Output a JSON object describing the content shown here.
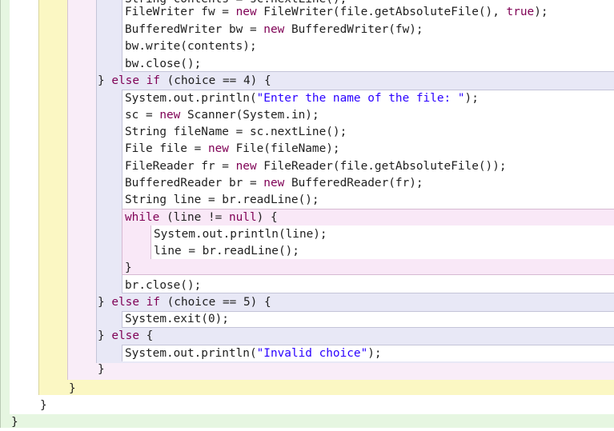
{
  "colors": {
    "class_bg": "#e6f6e1",
    "method_bg": "#fbf7c3",
    "loop_bg": "#f9edf8",
    "if_bg": "#e8e8f6",
    "block_bg": "#ffffff",
    "while_bg": "#f9e8f7"
  },
  "lines": [
    {
      "id": "l0",
      "parts": [
        [
          "plain",
          "String contents = sc.nextLine();"
        ]
      ]
    },
    {
      "id": "l1",
      "parts": [
        [
          "plain",
          "FileWriter fw = "
        ],
        [
          "kw",
          "new"
        ],
        [
          "plain",
          " FileWriter(file.getAbsoluteFile(), "
        ],
        [
          "kw",
          "true"
        ],
        [
          "plain",
          ");"
        ]
      ]
    },
    {
      "id": "l2",
      "parts": [
        [
          "plain",
          "BufferedWriter bw = "
        ],
        [
          "kw",
          "new"
        ],
        [
          "plain",
          " BufferedWriter(fw);"
        ]
      ]
    },
    {
      "id": "l3",
      "parts": [
        [
          "plain",
          "bw.write(contents);"
        ]
      ]
    },
    {
      "id": "l4",
      "parts": [
        [
          "plain",
          "bw.close();"
        ]
      ]
    },
    {
      "id": "l5",
      "parts": [
        [
          "plain",
          "} "
        ],
        [
          "kw",
          "else if"
        ],
        [
          "plain",
          " (choice == 4) {"
        ]
      ]
    },
    {
      "id": "l6",
      "parts": [
        [
          "plain",
          "System.out.println("
        ],
        [
          "str",
          "\"Enter the name of the file: \""
        ],
        [
          "plain",
          ");"
        ]
      ]
    },
    {
      "id": "l7",
      "parts": [
        [
          "plain",
          "sc = "
        ],
        [
          "kw",
          "new"
        ],
        [
          "plain",
          " Scanner(System.in);"
        ]
      ]
    },
    {
      "id": "l8",
      "parts": [
        [
          "plain",
          "String fileName = sc.nextLine();"
        ]
      ]
    },
    {
      "id": "l9",
      "parts": [
        [
          "plain",
          "File file = "
        ],
        [
          "kw",
          "new"
        ],
        [
          "plain",
          " File(fileName);"
        ]
      ]
    },
    {
      "id": "l10",
      "parts": [
        [
          "plain",
          "FileReader fr = "
        ],
        [
          "kw",
          "new"
        ],
        [
          "plain",
          " FileReader(file.getAbsoluteFile());"
        ]
      ]
    },
    {
      "id": "l11",
      "parts": [
        [
          "plain",
          "BufferedReader br = "
        ],
        [
          "kw",
          "new"
        ],
        [
          "plain",
          " BufferedReader(fr);"
        ]
      ]
    },
    {
      "id": "l12",
      "parts": [
        [
          "plain",
          "String line = br.readLine();"
        ]
      ]
    },
    {
      "id": "l13",
      "parts": [
        [
          "kw",
          "while"
        ],
        [
          "plain",
          " (line != "
        ],
        [
          "kw",
          "null"
        ],
        [
          "plain",
          ") {"
        ]
      ]
    },
    {
      "id": "l14",
      "parts": [
        [
          "plain",
          "System.out.println(line);"
        ]
      ]
    },
    {
      "id": "l15",
      "parts": [
        [
          "plain",
          "line = br.readLine();"
        ]
      ]
    },
    {
      "id": "l16",
      "parts": [
        [
          "plain",
          "}"
        ]
      ]
    },
    {
      "id": "l17",
      "parts": [
        [
          "plain",
          "br.close();"
        ]
      ]
    },
    {
      "id": "l18",
      "parts": [
        [
          "plain",
          "} "
        ],
        [
          "kw",
          "else if"
        ],
        [
          "plain",
          " (choice == 5) {"
        ]
      ]
    },
    {
      "id": "l19",
      "parts": [
        [
          "plain",
          "System.exit(0);"
        ]
      ]
    },
    {
      "id": "l20",
      "parts": [
        [
          "plain",
          "} "
        ],
        [
          "kw",
          "else"
        ],
        [
          "plain",
          " {"
        ]
      ]
    },
    {
      "id": "l21",
      "parts": [
        [
          "plain",
          "System.out.println("
        ],
        [
          "str",
          "\"Invalid choice\""
        ],
        [
          "plain",
          ");"
        ]
      ]
    },
    {
      "id": "l22",
      "parts": [
        [
          "plain",
          "}"
        ]
      ]
    },
    {
      "id": "l23",
      "parts": [
        [
          "plain",
          "}"
        ]
      ]
    },
    {
      "id": "l24",
      "parts": [
        [
          "plain",
          "}"
        ]
      ]
    },
    {
      "id": "l25",
      "parts": [
        [
          "plain",
          "}"
        ]
      ]
    }
  ]
}
